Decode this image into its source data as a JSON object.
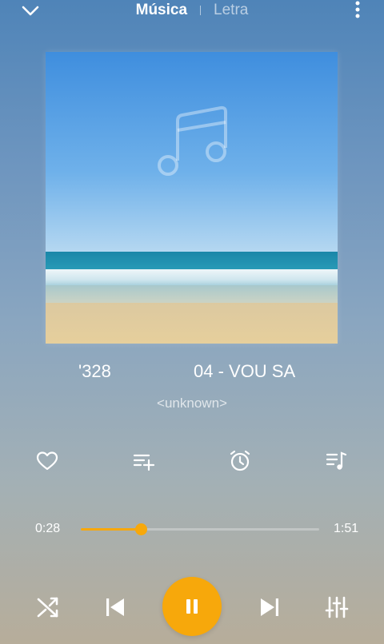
{
  "tabs": {
    "active": "Música",
    "inactive": "Letra"
  },
  "track": {
    "title_left": "'328",
    "title_right": "04 - VOU SA",
    "artist": "<unknown>"
  },
  "playback": {
    "elapsed": "0:28",
    "duration": "1:51",
    "progress_fraction": 0.253,
    "state": "playing"
  },
  "icons": {
    "back": "chevron-down-icon",
    "menu": "more-vertical-icon",
    "album": "music-note-icon",
    "favorite": "heart-icon",
    "add_queue": "playlist-add-icon",
    "timer": "alarm-clock-icon",
    "queue": "queue-music-icon",
    "shuffle": "shuffle-icon",
    "previous": "skip-previous-icon",
    "pause": "pause-icon",
    "next": "skip-next-icon",
    "equalizer": "equalizer-icon"
  },
  "colors": {
    "accent": "#f7a80b",
    "text": "#ffffff"
  }
}
